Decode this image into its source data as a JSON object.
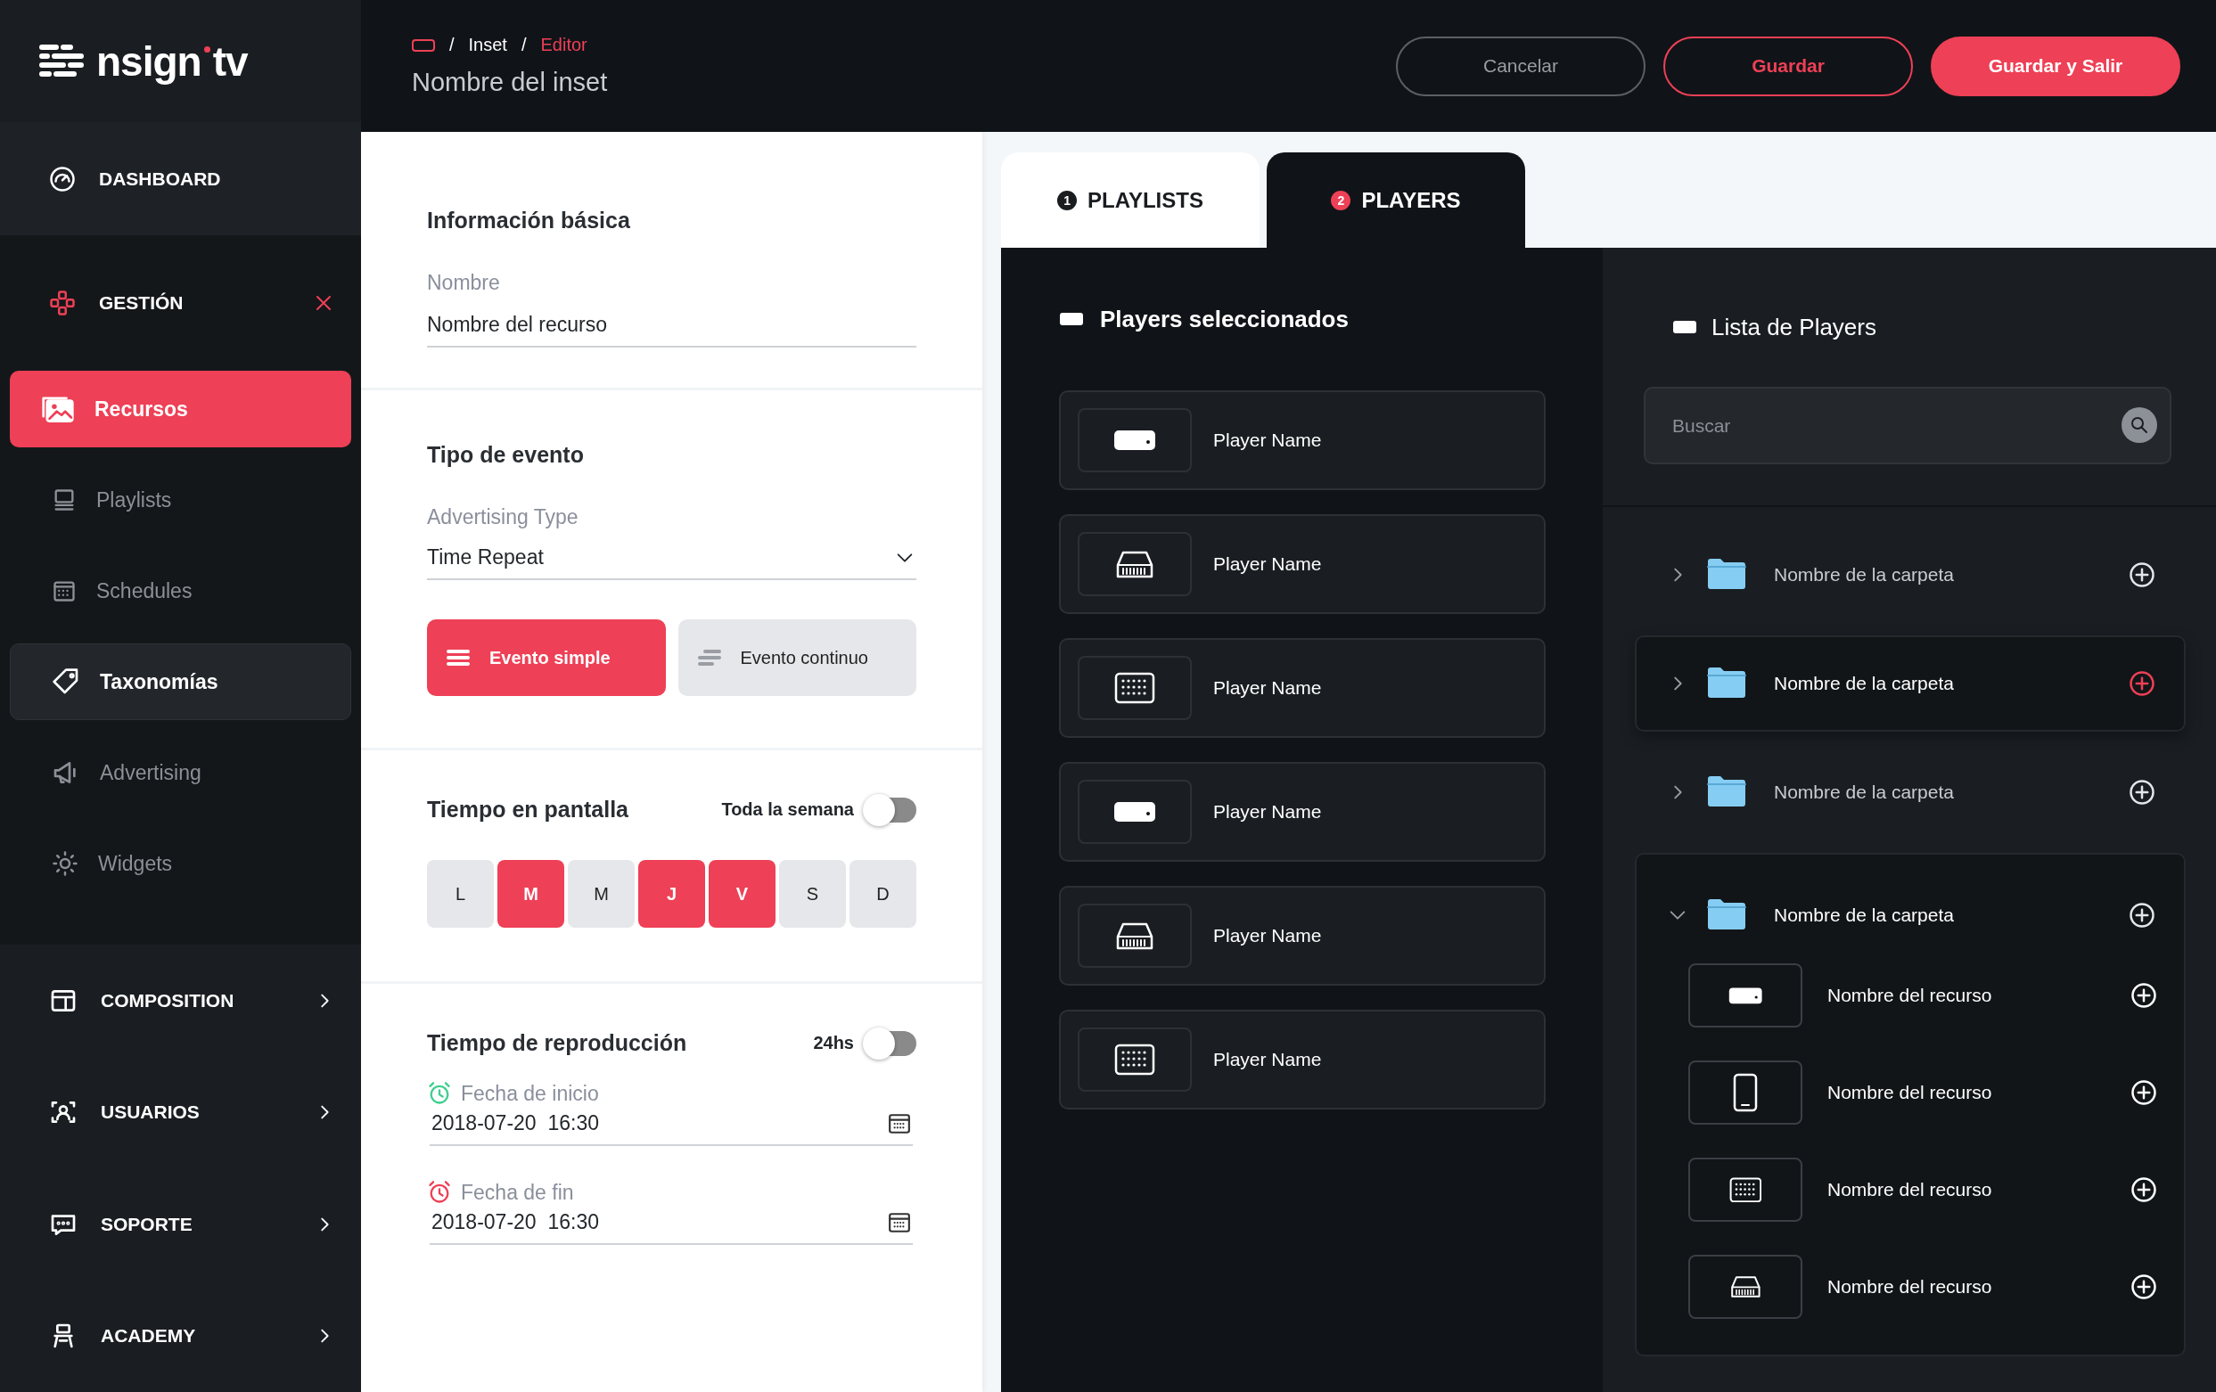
{
  "sidebar": {
    "logo": [
      "nsign",
      "tv"
    ],
    "items": [
      {
        "label": "DASHBOARD",
        "kind": "link"
      },
      {
        "label": "GESTIÓN",
        "kind": "group",
        "expanded": true,
        "children": [
          {
            "label": "Recursos",
            "selected": true,
            "highlighted": false
          },
          {
            "label": "Playlists",
            "selected": false,
            "highlighted": false
          },
          {
            "label": "Schedules",
            "selected": false,
            "highlighted": false
          },
          {
            "label": "Taxonomías",
            "selected": false,
            "highlighted": true
          },
          {
            "label": "Advertising",
            "selected": false,
            "highlighted": false
          },
          {
            "label": "Widgets",
            "selected": false,
            "highlighted": false
          }
        ]
      },
      {
        "label": "COMPOSITION",
        "kind": "group",
        "expanded": false
      },
      {
        "label": "USUARIOS",
        "kind": "group",
        "expanded": false
      },
      {
        "label": "SOPORTE",
        "kind": "group",
        "expanded": false
      },
      {
        "label": "ACADEMY",
        "kind": "group",
        "expanded": false
      }
    ]
  },
  "header": {
    "breadcrumb_separator": "/",
    "breadcrumb": [
      "Inset",
      "Editor"
    ],
    "title": "Nombre del inset",
    "buttons": [
      {
        "label": "Cancelar",
        "kind": "ghost"
      },
      {
        "label": "Guardar",
        "kind": "outline"
      },
      {
        "label": "Guardar y Salir",
        "kind": "primary"
      }
    ]
  },
  "form": {
    "basic": {
      "title": "Información básica",
      "label": "Nombre",
      "value": "Nombre del recurso"
    },
    "event": {
      "title": "Tipo de evento",
      "label": "Advertising Type",
      "value": "Time Repeat",
      "options": [
        {
          "label": "Evento simple",
          "selected": true
        },
        {
          "label": "Evento continuo",
          "selected": false
        }
      ]
    },
    "screen_time": {
      "title": "Tiempo en pantalla",
      "toggle_label": "Toda la semana",
      "on": false,
      "days": [
        {
          "label": "L",
          "selected": false
        },
        {
          "label": "M",
          "selected": true
        },
        {
          "label": "M",
          "selected": false
        },
        {
          "label": "J",
          "selected": true
        },
        {
          "label": "V",
          "selected": true
        },
        {
          "label": "S",
          "selected": false
        },
        {
          "label": "D",
          "selected": false
        }
      ]
    },
    "playback": {
      "title": "Tiempo de reproducción",
      "toggle_label": "24hs",
      "on": false,
      "dates": [
        {
          "label": "Fecha de inicio",
          "value": "2018-07-20  16:30",
          "color": "#3ecf8e"
        },
        {
          "label": "Fecha de fin",
          "value": "2018-07-20  16:30",
          "color": "#ee4056"
        }
      ]
    }
  },
  "tabs": [
    {
      "number": "1",
      "label": "PLAYLISTS",
      "selected": false
    },
    {
      "number": "2",
      "label": "PLAYERS",
      "selected": true
    }
  ],
  "selected_players": {
    "title": "Players seleccionados",
    "players": [
      {
        "name": "Player Name",
        "kind": "stick"
      },
      {
        "name": "Player Name",
        "kind": "router"
      },
      {
        "name": "Player Name",
        "kind": "keypad"
      },
      {
        "name": "Player Name",
        "kind": "stick"
      },
      {
        "name": "Player Name",
        "kind": "router"
      },
      {
        "name": "Player Name",
        "kind": "keypad"
      }
    ]
  },
  "player_list": {
    "title": "Lista de Players",
    "search": {
      "placeholder": "Buscar"
    },
    "folders": [
      {
        "name": "Nombre de la carpeta",
        "expanded": false,
        "highlighted": false
      },
      {
        "name": "Nombre de la carpeta",
        "expanded": false,
        "highlighted": true
      },
      {
        "name": "Nombre de la carpeta",
        "expanded": false,
        "highlighted": false
      },
      {
        "name": "Nombre de la carpeta",
        "expanded": true,
        "highlighted": false,
        "children": [
          {
            "name": "Nombre del recurso",
            "kind": "stick"
          },
          {
            "name": "Nombre del recurso",
            "kind": "tablet"
          },
          {
            "name": "Nombre del recurso",
            "kind": "keypad"
          },
          {
            "name": "Nombre del recurso",
            "kind": "router"
          }
        ]
      }
    ]
  }
}
